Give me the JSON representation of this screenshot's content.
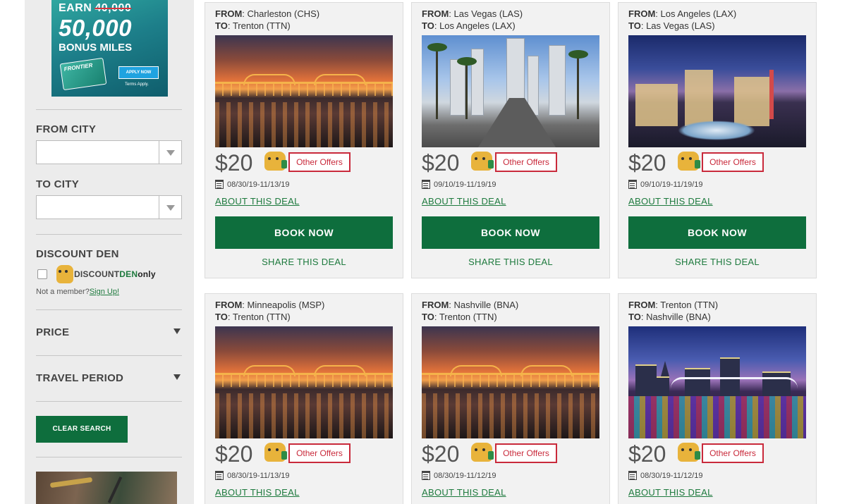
{
  "promo": {
    "earn": "EARN",
    "old_miles": "40,000",
    "new_miles": "50,000",
    "bonus": "BONUS MILES",
    "card_brand": "FRONTIER",
    "apply": "APPLY NOW",
    "terms": "Terms Apply."
  },
  "sidebar": {
    "from_city_label": "FROM CITY",
    "from_city_value": "",
    "to_city_label": "TO CITY",
    "to_city_value": "",
    "discount_den_label": "DISCOUNT DEN",
    "den_logo": {
      "prefix": "DIS",
      "mid": "COUNT",
      "den": "DEN",
      "only": "only"
    },
    "not_member": "Not a member?",
    "sign_up": "Sign Up!",
    "price_label": "PRICE",
    "travel_period_label": "TRAVEL PERIOD",
    "clear_search": "CLEAR SEARCH"
  },
  "deal_common": {
    "from_label": "FROM",
    "to_label": "TO",
    "other_offers": "Other Offers",
    "about": "ABOUT THIS DEAL",
    "book": "BOOK NOW",
    "share": "SHARE THIS DEAL"
  },
  "deals": [
    {
      "from": "Charleston (CHS)",
      "to": "Trenton (TTN)",
      "price": "$20",
      "dates": "08/30/19-11/13/19"
    },
    {
      "from": "Las Vegas (LAS)",
      "to": "Los Angeles (LAX)",
      "price": "$20",
      "dates": "09/10/19-11/19/19"
    },
    {
      "from": "Los Angeles (LAX)",
      "to": "Las Vegas (LAS)",
      "price": "$20",
      "dates": "09/10/19-11/19/19"
    },
    {
      "from": "Minneapolis (MSP)",
      "to": "Trenton (TTN)",
      "price": "$20",
      "dates": "08/30/19-11/13/19"
    },
    {
      "from": "Nashville (BNA)",
      "to": "Trenton (TTN)",
      "price": "$20",
      "dates": "08/30/19-11/12/19"
    },
    {
      "from": "Trenton (TTN)",
      "to": "Nashville (BNA)",
      "price": "$20",
      "dates": "08/30/19-11/12/19"
    }
  ],
  "colors": {
    "brand_green": "#0e6e3d",
    "offers_red": "#c92a3b",
    "sidebar_bg": "#ececec",
    "card_bg": "#f2f2f2"
  }
}
